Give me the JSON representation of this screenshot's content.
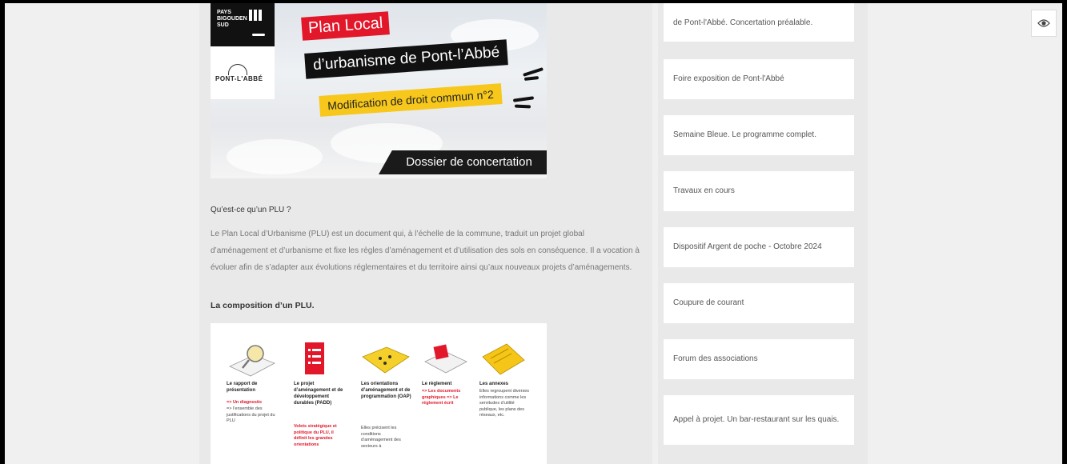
{
  "banner": {
    "logo_top": "PAYS BIGOUDEN SUD",
    "logo_bottom": "PONT-L'ABBÉ",
    "title_line1": "Plan Local",
    "title_line2": "d’urbanisme de Pont-l’Abbé",
    "title_line3": "Modification de droit commun n°2",
    "subtitle": "Dossier de concertation"
  },
  "article": {
    "question": "Qu’est-ce qu’un PLU ?",
    "paragraph": "Le Plan Local d’Urbanisme (PLU) est un document qui, à l’échelle de la commune, traduit un projet global d’aménagement et d’urbanisme et fixe les règles d’aménagement et d’utilisation des sols en conséquence. Il a vocation à évoluer afin de s’adapter aux évolutions réglementaires et du territoire ainsi qu’aux nouveaux projets d’aménagements.",
    "composition_heading": "La composition d’un PLU."
  },
  "diagram": [
    {
      "title": "Le rapport de présentation",
      "red": "=> Un diagnostic",
      "desc": "=> l’ensemble des justifications du projet du PLU"
    },
    {
      "title": "Le projet d’aménagement et de développement durables (PADD)",
      "red": "Volets stratégique et politique du PLU, il définit les grandes orientations",
      "desc": ""
    },
    {
      "title": "Les orientations d’aménagement et de programmation (OAP)",
      "red": "",
      "desc": "Elles précisent les conditions d’aménagement des secteurs à"
    },
    {
      "title": "Le règlement",
      "red": "=> Les documents graphiques => Le règlement écrit",
      "desc": ""
    },
    {
      "title": "Les annexes",
      "red": "",
      "desc": "Elles regroupent diverses informations comme les servitudes d’utilité publique, les plans des réseaux, etc."
    }
  ],
  "sidebar": {
    "items": [
      {
        "label": "de Pont-l'Abbé. Concertation préalable."
      },
      {
        "label": "Foire exposition de Pont-l'Abbé"
      },
      {
        "label": "Semaine Bleue. Le programme complet."
      },
      {
        "label": "Travaux en cours"
      },
      {
        "label": "Dispositif Argent de poche - Octobre 2024"
      },
      {
        "label": "Coupure de courant"
      },
      {
        "label": "Forum des associations"
      },
      {
        "label": "Appel à projet. Un bar-restaurant sur les quais."
      }
    ]
  },
  "accessibility_button": {
    "icon": "eye-icon"
  },
  "colors": {
    "red": "#e2172a",
    "yellow": "#f7c81b",
    "dark": "#111111"
  }
}
